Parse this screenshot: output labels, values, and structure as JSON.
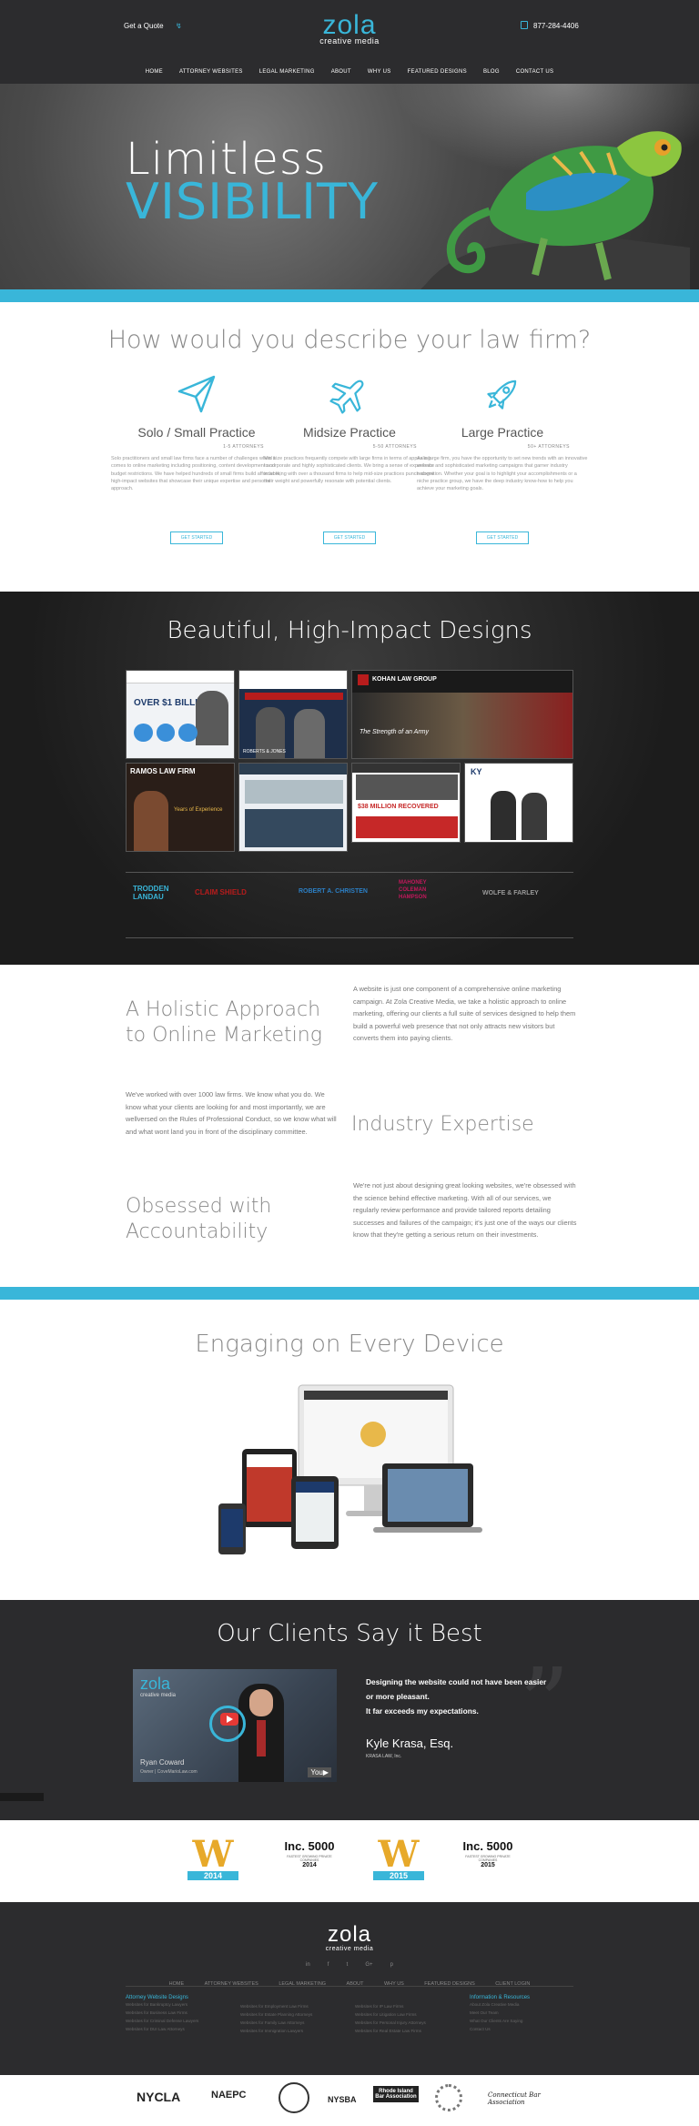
{
  "header": {
    "quote_label": "Get a Quote",
    "logo_word": "zola",
    "logo_sub": "creative media",
    "phone": "877-284-4406"
  },
  "nav": [
    "HOME",
    "ATTORNEY WEBSITES",
    "LEGAL MARKETING",
    "ABOUT",
    "WHY US",
    "FEATURED DESIGNS",
    "BLOG",
    "CONTACT US"
  ],
  "hero": {
    "line1": "Limitless",
    "line2": "VISIBILITY"
  },
  "lawfirm": {
    "title": "How would you describe your law firm?",
    "columns": [
      {
        "icon": "paper-plane-icon",
        "title": "Solo / Small Practice",
        "sub": "1-5 ATTORNEYS",
        "text": "Solo practitioners and small law firms face a number of challenges when it comes to online marketing including positioning, content development and budget restrictions. We have helped hundreds of small firms build affordable, high-impact websites that showcase their unique expertise and personal approach.",
        "button": "GET STARTED"
      },
      {
        "icon": "airplane-icon",
        "title": "Midsize Practice",
        "sub": "5-50 ATTORNEYS",
        "text": "Mid size practices frequently compete with large firms in terms of appealing to corporate and highly sophisticated clients. We bring a sense of experience in working with over a thousand firms to help mid-size practices punch above their weight and powerfully resonate with potential clients.",
        "button": "GET STARTED"
      },
      {
        "icon": "rocket-icon",
        "title": "Large Practice",
        "sub": "50+ ATTORNEYS",
        "text": "As a large firm, you have the opportunity to set new trends with an innovative website and sophisticated marketing campaigns that garner industry recognition. Whether your goal is to highlight your accomplishments or a niche practice group, we have the deep industry know-how to help you achieve your marketing goals.",
        "button": "GET STARTED"
      }
    ]
  },
  "designs": {
    "title": "Beautiful, High-Impact Designs",
    "thumbs": [
      {
        "label": "OVER $1 BILLION"
      },
      {
        "label": "ROBERTS & JONES"
      },
      {
        "label": "KOHAN LAW GROUP",
        "sub": "The Strength of an Army"
      },
      {
        "label": "RAMOS LAW FIRM",
        "sub": "Years of Experience"
      },
      {
        "label": "$38 MILLION RECOVERED"
      },
      {
        "label": "KY"
      }
    ],
    "client_logos": [
      "TRODDEN LANDAU",
      "CLAIM SHIELD",
      "ROBERT A. CHRISTEN",
      "MAHONEY COLEMAN HAMPSON",
      "WOLFE & FARLEY"
    ]
  },
  "holistic": {
    "head1": [
      "A Holistic Approach",
      "to Online Marketing"
    ],
    "text1": "A website is just one component of a comprehensive online marketing campaign. At Zola Creative Media, we take a holistic approach to online marketing, offering our clients a full suite of services designed to help them build a powerful web presence that not only attracts new visitors but converts them into paying clients.",
    "text2": "We've worked with over 1000 law firms. We know what you do. We know what your clients are looking for and most importantly, we are wellversed on the Rules of Professional Conduct, so we know what will and what wont land you in front of the disciplinary committee.",
    "head2": "Industry Expertise",
    "head3": [
      "Obsessed with",
      "Accountability"
    ],
    "text3": "We're not just about designing great looking websites, we're obsessed with the science behind effective marketing. With all of our services, we regularly review performance and provide tailored reports detailing successes and failures of the campaign; it's just one of the ways our clients know that they're getting a serious return on their investments."
  },
  "devices": {
    "title": "Engaging on Every Device"
  },
  "testimonials": {
    "title": "Our Clients Say it Best",
    "video_logo": "zola",
    "video_logo_sub": "creative media",
    "video_name": "Ryan Coward",
    "video_role": "Owner | CoveMarioLaw.com",
    "quote": [
      "Designing the website could not have been easier",
      "or more pleasant.",
      "It far exceeds my expectations."
    ],
    "name": "Kyle Krasa, Esq.",
    "company": "KRASA LAW, Inc."
  },
  "awards": [
    {
      "type": "W",
      "year": "2014",
      "color": "#e7a92a"
    },
    {
      "type": "Inc. 5000",
      "year": "2014",
      "color": "#d6252b"
    },
    {
      "type": "W",
      "year": "2015",
      "color": "#e7a92a"
    },
    {
      "type": "Inc. 5000",
      "year": "2015",
      "color": "#d6252b"
    }
  ],
  "awards_caption": "FASTEST GROWING PRIVATE COMPANIES",
  "footer": {
    "logo_word": "zola",
    "logo_sub": "creative media",
    "nav": [
      "HOME",
      "ATTORNEY WEBSITES",
      "LEGAL MARKETING",
      "ABOUT",
      "WHY US",
      "FEATURED DESIGNS",
      "CLIENT LOGIN"
    ],
    "col1_title": "Attorney Website Designs",
    "col1": [
      "Websites for Bankruptcy Lawyers",
      "Websites for Business Law Firms",
      "Websites for Criminal Defense Lawyers",
      "Websites for DUI Law Attorneys"
    ],
    "col2": [
      "Websites for Employment Law Firms",
      "Websites for Estate Planning Attorneys",
      "Websites for Family Law Attorneys",
      "Websites for Immigration Lawyers"
    ],
    "col3": [
      "Websites for IP Law Firms",
      "Websites for Litigation Law Firms",
      "Websites for Personal Injury Attorneys",
      "Websites for Real Estate Law Firms"
    ],
    "col4_title": "Information & Resources",
    "col4": [
      "About Zola Creative Media",
      "Meet Our Team",
      "What Our Clients Are Saying",
      "Contact Us"
    ]
  },
  "memberships": [
    "NYCLA",
    "NAEPC",
    "NYSBA",
    "Rhode Island Bar Association",
    "Connecticut Bar Association"
  ]
}
